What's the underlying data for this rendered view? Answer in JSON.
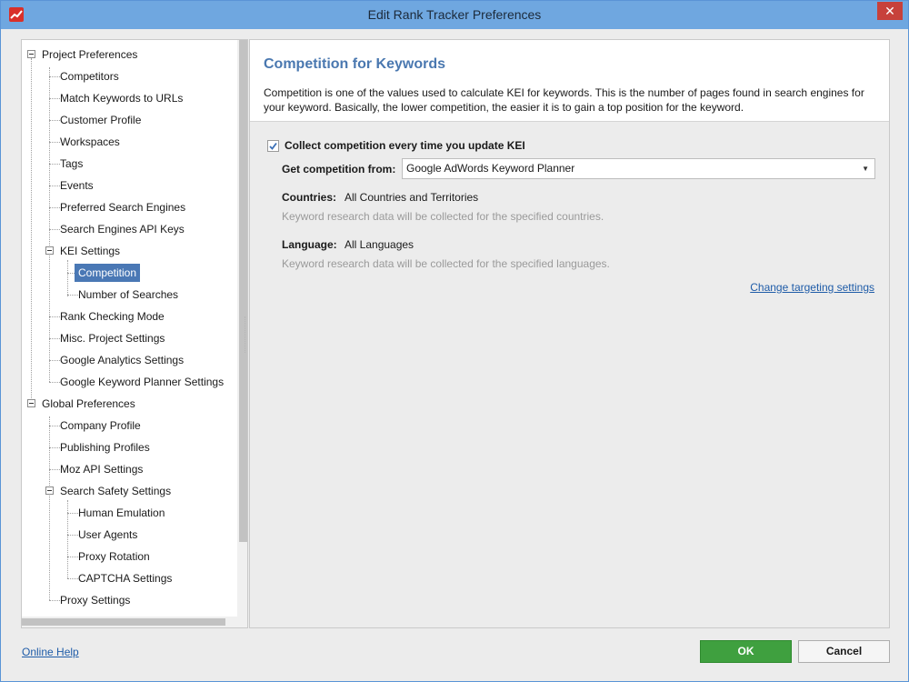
{
  "window": {
    "title": "Edit Rank Tracker Preferences",
    "close_glyph": "✕"
  },
  "tree": {
    "project_preferences": "Project Preferences",
    "competitors": "Competitors",
    "match_keywords": "Match Keywords to URLs",
    "customer_profile": "Customer Profile",
    "workspaces": "Workspaces",
    "tags": "Tags",
    "events": "Events",
    "preferred_search_engines": "Preferred Search Engines",
    "search_engines_api_keys": "Search Engines API Keys",
    "kei_settings": "KEI Settings",
    "competition": "Competition",
    "number_of_searches": "Number of Searches",
    "rank_checking_mode": "Rank Checking Mode",
    "misc_project_settings": "Misc. Project Settings",
    "google_analytics_settings": "Google Analytics Settings",
    "google_keyword_planner_settings": "Google Keyword Planner Settings",
    "global_preferences": "Global Preferences",
    "company_profile": "Company Profile",
    "publishing_profiles": "Publishing Profiles",
    "moz_api_settings": "Moz API Settings",
    "search_safety_settings": "Search Safety Settings",
    "human_emulation": "Human Emulation",
    "user_agents": "User Agents",
    "proxy_rotation": "Proxy Rotation",
    "captcha_settings": "CAPTCHA Settings",
    "proxy_settings": "Proxy Settings"
  },
  "content": {
    "title": "Competition for Keywords",
    "description": "Competition is one of the values used to calculate KEI for keywords. This is the number of pages found in search engines for your keyword. Basically, the lower competition, the easier it is to gain a top position for the keyword.",
    "collect_checkbox_label": "Collect competition every time you update KEI",
    "collect_checked": true,
    "get_from_label": "Get competition from:",
    "get_from_value": "Google AdWords Keyword Planner",
    "countries_label": "Countries:",
    "countries_value": "All Countries and Territories",
    "countries_hint": "Keyword research data will be collected for the specified countries.",
    "language_label": "Language:",
    "language_value": "All Languages",
    "language_hint": "Keyword research data will be collected for the specified languages.",
    "change_targeting_link": "Change targeting settings"
  },
  "footer": {
    "online_help": "Online Help",
    "ok": "OK",
    "cancel": "Cancel"
  },
  "colors": {
    "titlebar": "#6fa7e0",
    "accent_title": "#4a78b0",
    "selection": "#4a78b5",
    "ok_button": "#3fa03f",
    "close_button": "#c7413b",
    "link": "#1f5ca8"
  }
}
